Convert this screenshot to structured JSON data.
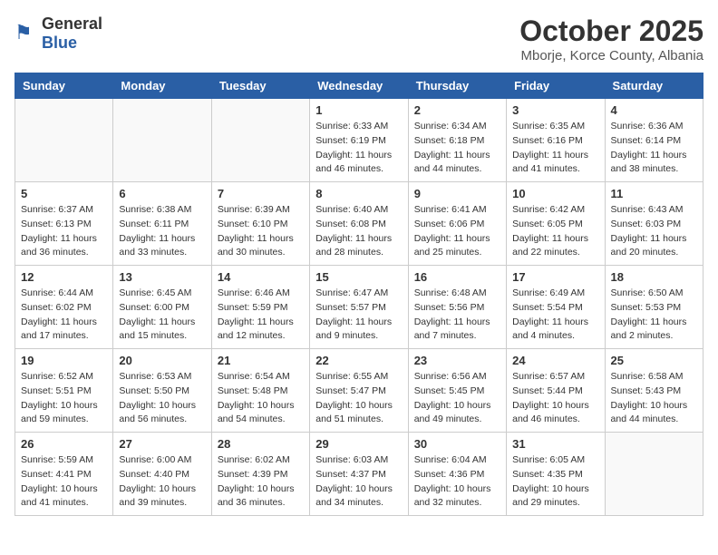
{
  "header": {
    "logo_general": "General",
    "logo_blue": "Blue",
    "month_title": "October 2025",
    "location": "Mborje, Korce County, Albania"
  },
  "weekdays": [
    "Sunday",
    "Monday",
    "Tuesday",
    "Wednesday",
    "Thursday",
    "Friday",
    "Saturday"
  ],
  "weeks": [
    [
      {
        "day": "",
        "info": ""
      },
      {
        "day": "",
        "info": ""
      },
      {
        "day": "",
        "info": ""
      },
      {
        "day": "1",
        "info": "Sunrise: 6:33 AM\nSunset: 6:19 PM\nDaylight: 11 hours\nand 46 minutes."
      },
      {
        "day": "2",
        "info": "Sunrise: 6:34 AM\nSunset: 6:18 PM\nDaylight: 11 hours\nand 44 minutes."
      },
      {
        "day": "3",
        "info": "Sunrise: 6:35 AM\nSunset: 6:16 PM\nDaylight: 11 hours\nand 41 minutes."
      },
      {
        "day": "4",
        "info": "Sunrise: 6:36 AM\nSunset: 6:14 PM\nDaylight: 11 hours\nand 38 minutes."
      }
    ],
    [
      {
        "day": "5",
        "info": "Sunrise: 6:37 AM\nSunset: 6:13 PM\nDaylight: 11 hours\nand 36 minutes."
      },
      {
        "day": "6",
        "info": "Sunrise: 6:38 AM\nSunset: 6:11 PM\nDaylight: 11 hours\nand 33 minutes."
      },
      {
        "day": "7",
        "info": "Sunrise: 6:39 AM\nSunset: 6:10 PM\nDaylight: 11 hours\nand 30 minutes."
      },
      {
        "day": "8",
        "info": "Sunrise: 6:40 AM\nSunset: 6:08 PM\nDaylight: 11 hours\nand 28 minutes."
      },
      {
        "day": "9",
        "info": "Sunrise: 6:41 AM\nSunset: 6:06 PM\nDaylight: 11 hours\nand 25 minutes."
      },
      {
        "day": "10",
        "info": "Sunrise: 6:42 AM\nSunset: 6:05 PM\nDaylight: 11 hours\nand 22 minutes."
      },
      {
        "day": "11",
        "info": "Sunrise: 6:43 AM\nSunset: 6:03 PM\nDaylight: 11 hours\nand 20 minutes."
      }
    ],
    [
      {
        "day": "12",
        "info": "Sunrise: 6:44 AM\nSunset: 6:02 PM\nDaylight: 11 hours\nand 17 minutes."
      },
      {
        "day": "13",
        "info": "Sunrise: 6:45 AM\nSunset: 6:00 PM\nDaylight: 11 hours\nand 15 minutes."
      },
      {
        "day": "14",
        "info": "Sunrise: 6:46 AM\nSunset: 5:59 PM\nDaylight: 11 hours\nand 12 minutes."
      },
      {
        "day": "15",
        "info": "Sunrise: 6:47 AM\nSunset: 5:57 PM\nDaylight: 11 hours\nand 9 minutes."
      },
      {
        "day": "16",
        "info": "Sunrise: 6:48 AM\nSunset: 5:56 PM\nDaylight: 11 hours\nand 7 minutes."
      },
      {
        "day": "17",
        "info": "Sunrise: 6:49 AM\nSunset: 5:54 PM\nDaylight: 11 hours\nand 4 minutes."
      },
      {
        "day": "18",
        "info": "Sunrise: 6:50 AM\nSunset: 5:53 PM\nDaylight: 11 hours\nand 2 minutes."
      }
    ],
    [
      {
        "day": "19",
        "info": "Sunrise: 6:52 AM\nSunset: 5:51 PM\nDaylight: 10 hours\nand 59 minutes."
      },
      {
        "day": "20",
        "info": "Sunrise: 6:53 AM\nSunset: 5:50 PM\nDaylight: 10 hours\nand 56 minutes."
      },
      {
        "day": "21",
        "info": "Sunrise: 6:54 AM\nSunset: 5:48 PM\nDaylight: 10 hours\nand 54 minutes."
      },
      {
        "day": "22",
        "info": "Sunrise: 6:55 AM\nSunset: 5:47 PM\nDaylight: 10 hours\nand 51 minutes."
      },
      {
        "day": "23",
        "info": "Sunrise: 6:56 AM\nSunset: 5:45 PM\nDaylight: 10 hours\nand 49 minutes."
      },
      {
        "day": "24",
        "info": "Sunrise: 6:57 AM\nSunset: 5:44 PM\nDaylight: 10 hours\nand 46 minutes."
      },
      {
        "day": "25",
        "info": "Sunrise: 6:58 AM\nSunset: 5:43 PM\nDaylight: 10 hours\nand 44 minutes."
      }
    ],
    [
      {
        "day": "26",
        "info": "Sunrise: 5:59 AM\nSunset: 4:41 PM\nDaylight: 10 hours\nand 41 minutes."
      },
      {
        "day": "27",
        "info": "Sunrise: 6:00 AM\nSunset: 4:40 PM\nDaylight: 10 hours\nand 39 minutes."
      },
      {
        "day": "28",
        "info": "Sunrise: 6:02 AM\nSunset: 4:39 PM\nDaylight: 10 hours\nand 36 minutes."
      },
      {
        "day": "29",
        "info": "Sunrise: 6:03 AM\nSunset: 4:37 PM\nDaylight: 10 hours\nand 34 minutes."
      },
      {
        "day": "30",
        "info": "Sunrise: 6:04 AM\nSunset: 4:36 PM\nDaylight: 10 hours\nand 32 minutes."
      },
      {
        "day": "31",
        "info": "Sunrise: 6:05 AM\nSunset: 4:35 PM\nDaylight: 10 hours\nand 29 minutes."
      },
      {
        "day": "",
        "info": ""
      }
    ]
  ]
}
